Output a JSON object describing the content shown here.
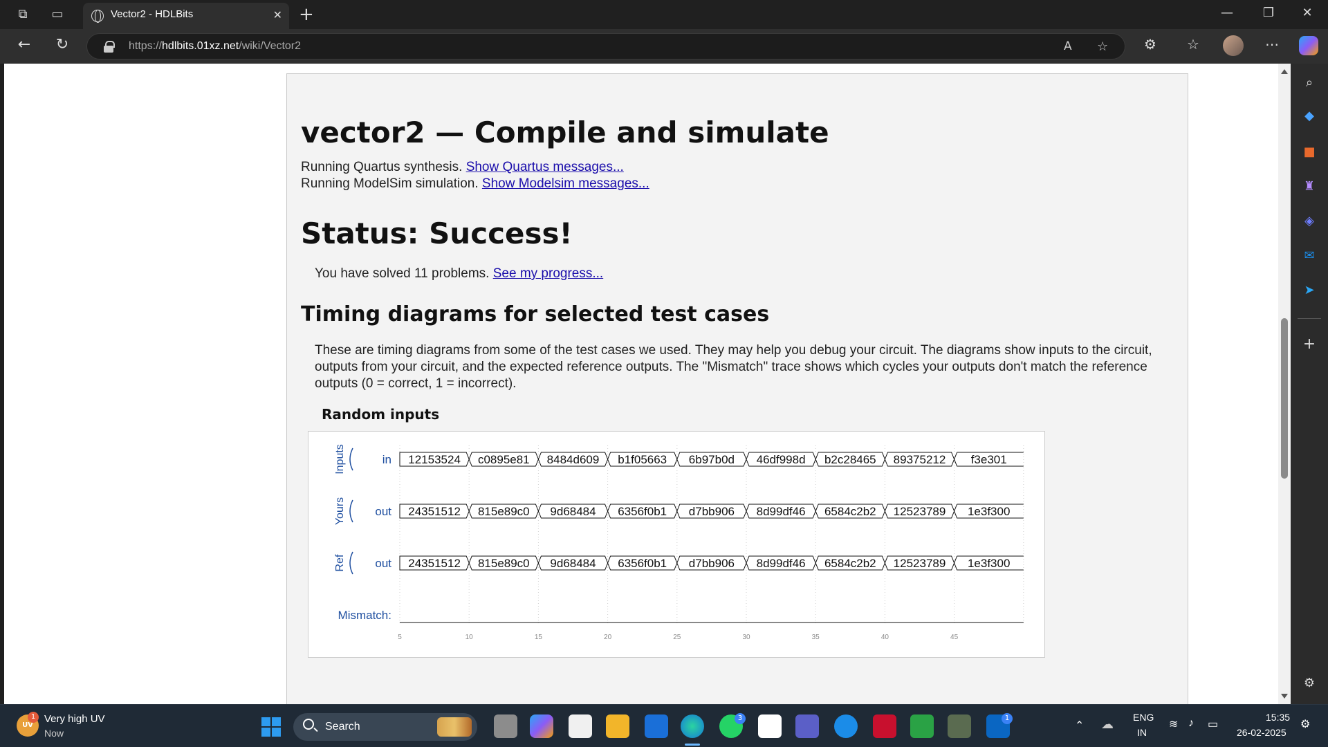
{
  "browser": {
    "tab_title": "Vector2 - HDLBits",
    "url_host": "hdlbits.01xz.net",
    "url_prefix": "https://",
    "url_path": "/wiki/Vector2"
  },
  "page": {
    "title": "vector2 — Compile and simulate",
    "quartus_text": "Running Quartus synthesis. ",
    "quartus_link": "Show Quartus messages...",
    "modelsim_text": "Running ModelSim simulation. ",
    "modelsim_link": "Show Modelsim messages...",
    "status": "Status: Success!",
    "solved_text": "You have solved 11 problems. ",
    "progress_link": "See my progress...",
    "timing_heading": "Timing diagrams for selected test cases",
    "timing_desc": "These are timing diagrams from some of the test cases we used. They may help you debug your circuit. The diagrams show inputs to the circuit, outputs from your circuit, and the expected reference outputs. The \"Mismatch\" trace shows which cycles your outputs don't match the reference outputs (0 = correct, 1 = incorrect).",
    "random_inputs": "Random inputs"
  },
  "waveform": {
    "groups": [
      "Inputs",
      "Yours",
      "Ref"
    ],
    "signals": [
      {
        "name": "in",
        "values": [
          "12153524",
          "c0895e81",
          "8484d609",
          "b1f05663",
          "6b97b0d",
          "46df998d",
          "b2c28465",
          "89375212",
          "f3e301"
        ]
      },
      {
        "name": "out",
        "values": [
          "24351512",
          "815e89c0",
          "9d68484",
          "6356f0b1",
          "d7bb906",
          "8d99df46",
          "6584c2b2",
          "12523789",
          "1e3f300"
        ]
      },
      {
        "name": "out",
        "values": [
          "24351512",
          "815e89c0",
          "9d68484",
          "6356f0b1",
          "d7bb906",
          "8d99df46",
          "6584c2b2",
          "12523789",
          "1e3f300"
        ]
      }
    ],
    "mismatch_label": "Mismatch:",
    "ticks": [
      "5",
      "10",
      "15",
      "20",
      "25",
      "30",
      "35",
      "40",
      "45"
    ],
    "color": "#1f4fa0"
  },
  "taskbar": {
    "weather_title": "Very high UV",
    "weather_sub": "Now",
    "weather_badge": "1",
    "weather_icon": "UV",
    "search": "Search",
    "whatsapp_badge": "3",
    "linkedin_badge": "1",
    "lang1": "ENG",
    "lang2": "IN",
    "time": "15:35",
    "date": "26-02-2025"
  }
}
